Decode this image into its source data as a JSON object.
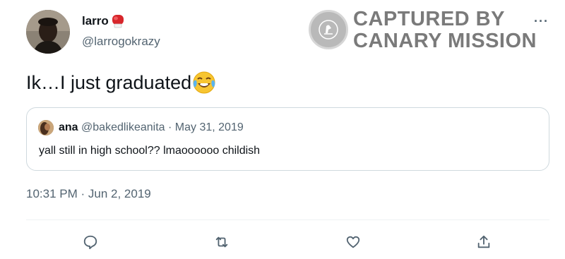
{
  "author": {
    "display_name": "larro",
    "name_emoji_icon": "boxing-glove-icon",
    "handle": "@larrogokrazy"
  },
  "watermark": {
    "line1": "CAPTURED BY",
    "line2": "CANARY MISSION"
  },
  "more_icon": "more-options-icon",
  "more_glyph": "···",
  "tweet": {
    "text": "Ik…I just graduated",
    "emoji_icon": "face-with-tears-of-joy-icon"
  },
  "quoted": {
    "name": "ana",
    "handle": "@bakedlikeanita",
    "separator": " · ",
    "date": "May 31, 2019",
    "text": "yall still in high school?? lmaoooooo childish"
  },
  "timestamp": "10:31 PM · Jun 2, 2019",
  "actions": [
    "reply-icon",
    "retweet-icon",
    "like-icon",
    "share-icon"
  ],
  "colors": {
    "text_primary": "#0f1419",
    "text_secondary": "#536471",
    "border": "#cfd9de",
    "watermark": "#7a7a7a"
  }
}
